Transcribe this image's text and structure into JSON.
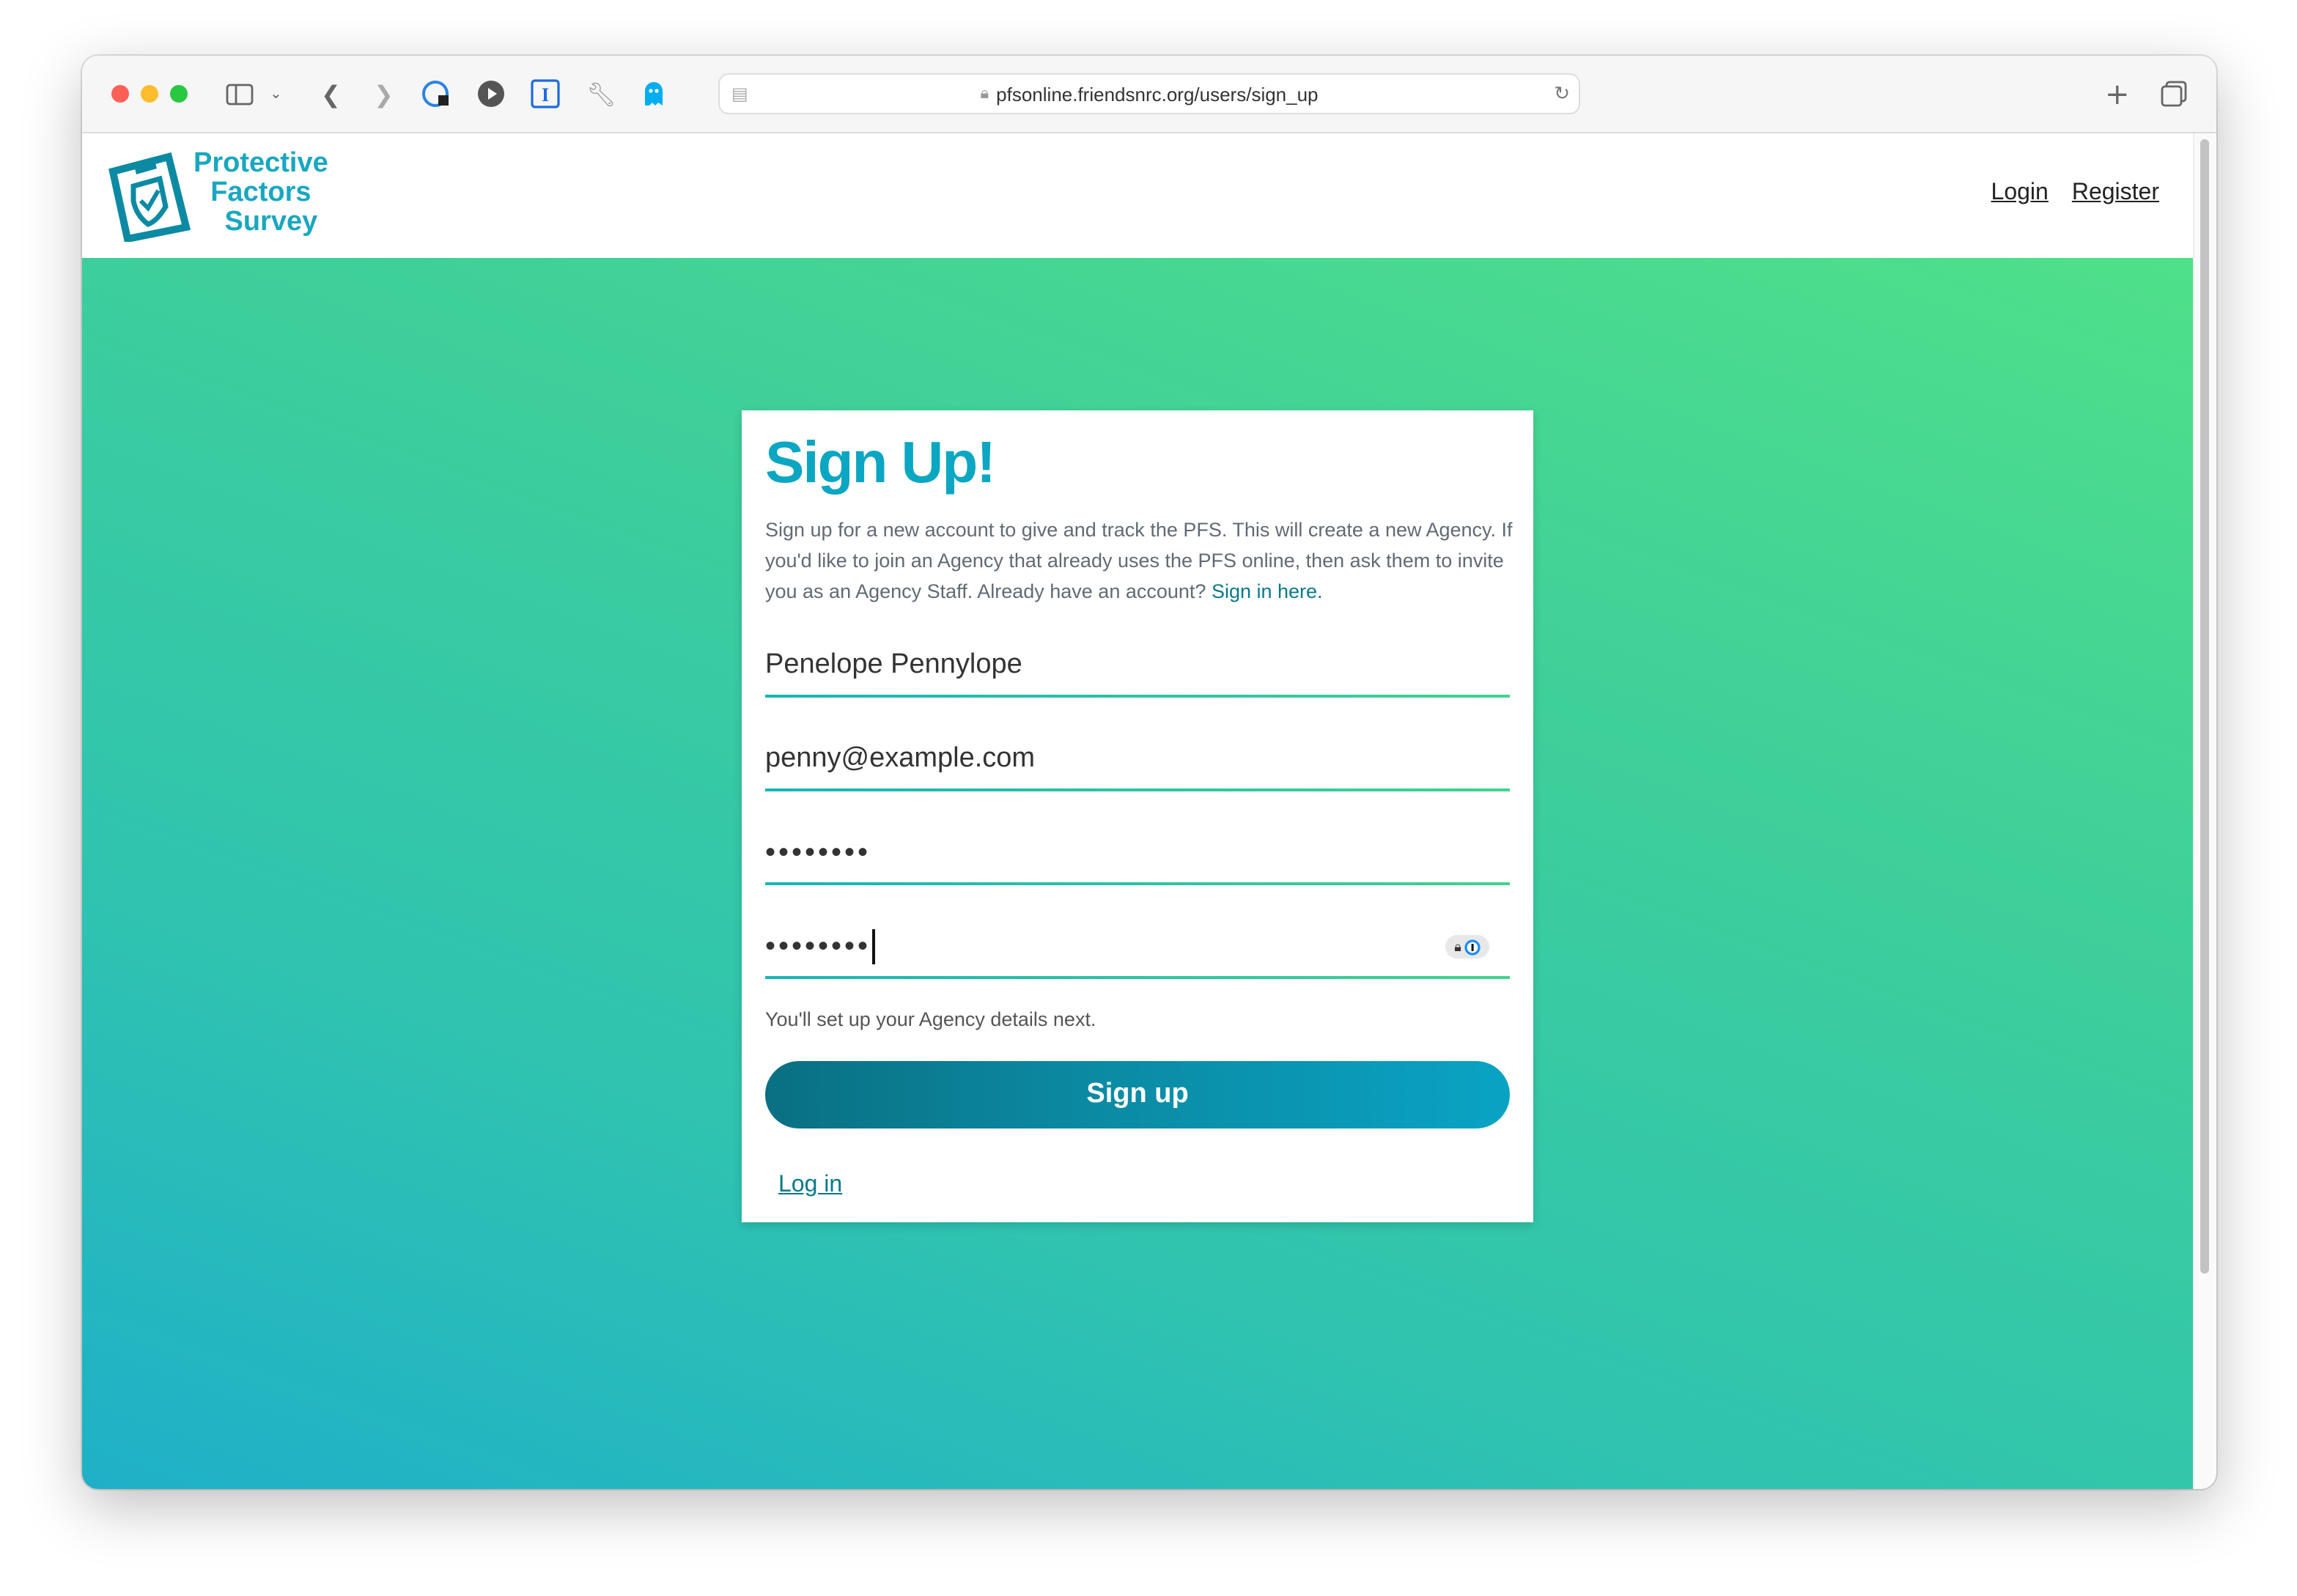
{
  "browser": {
    "url": "pfsonline.friendsnrc.org/users/sign_up",
    "icons": [
      "sidebar-icon",
      "chevron-down-icon",
      "back-icon",
      "forward-icon",
      "password-extension-icon",
      "play-icon",
      "instapaper-icon",
      "wrench-icon",
      "ghostery-icon",
      "reader-icon",
      "lock-icon",
      "reload-icon",
      "new-tab-icon",
      "tabs-overview-icon"
    ]
  },
  "header": {
    "logo_lines": [
      "Protective",
      "Factors",
      "Survey"
    ],
    "nav": {
      "login": "Login",
      "register": "Register"
    }
  },
  "card": {
    "title": "Sign Up!",
    "intro": "Sign up for a new account to give and track the PFS. This will create a new Agency. If you'd like to join an Agency that already uses the PFS online, then ask them to invite you as an Agency Staff. Already have an account? ",
    "intro_link": "Sign in here.",
    "fields": {
      "name": "Penelope Pennylope",
      "email": "penny@example.com",
      "password": "••••••••",
      "password_confirmation": "••••••••"
    },
    "hint": "You'll set up your Agency details next.",
    "submit": "Sign up",
    "login_link": "Log in"
  },
  "colors": {
    "accent": "#0ba6c2",
    "link": "#08788c",
    "gradient_top": "#4fe08a",
    "gradient_bottom": "#1fb0c8"
  }
}
